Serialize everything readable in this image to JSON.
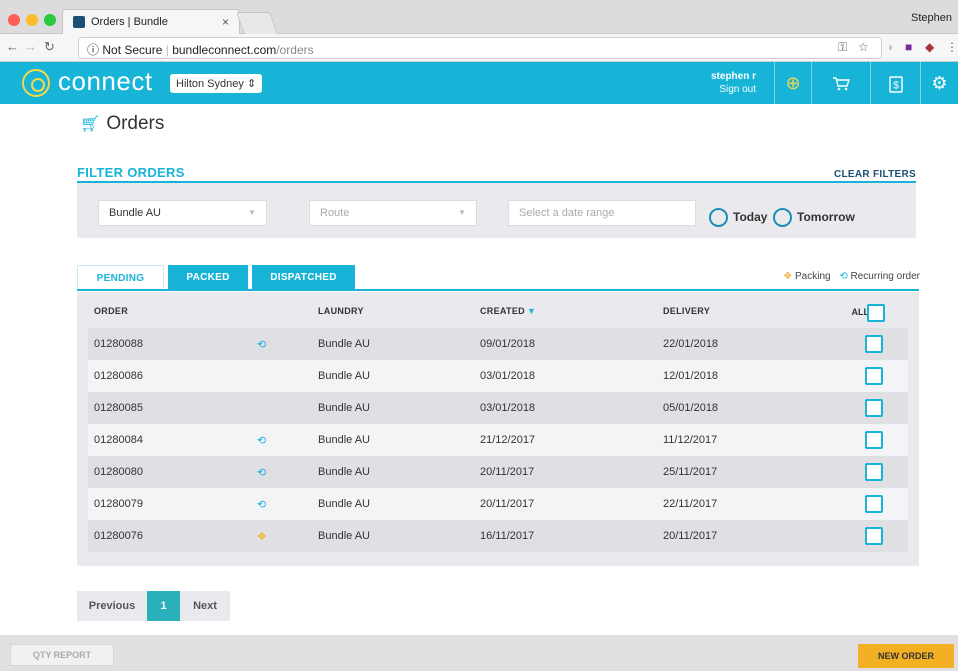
{
  "browser": {
    "tab_title": "Orders | Bundle",
    "tab_close": "×",
    "profile_name": "Stephen",
    "security_label": "Not Secure",
    "url_host": "bundleconnect.com",
    "url_path": "/orders",
    "info_glyph": "ⓘ"
  },
  "header": {
    "brand": "connect",
    "venue": "Hilton Sydney",
    "venue_caret": "⇕",
    "user_name": "stephen r",
    "sign_out": "Sign out",
    "icons": [
      "plus-circle-icon",
      "cart-icon",
      "invoice-icon",
      "settings-icon"
    ],
    "accent_color": "#17b4d8",
    "highlight_color": "#f2d84b"
  },
  "page": {
    "title": "Orders",
    "title_icon": "cart-icon"
  },
  "filters": {
    "label": "FILTER ORDERS",
    "clear_label": "CLEAR FILTERS",
    "laundry_value": "Bundle AU",
    "route_placeholder": "Route",
    "date_placeholder": "Select a date range",
    "today_label": "Today",
    "tomorrow_label": "Tomorrow"
  },
  "tabs": [
    {
      "label": "PENDING",
      "active": true
    },
    {
      "label": "PACKED",
      "active": false
    },
    {
      "label": "DISPATCHED",
      "active": false
    }
  ],
  "legend": {
    "packing_label": "Packing",
    "recurring_label": "Recurring order",
    "packing_color": "#f0b23a",
    "recurring_color": "#17b4d8"
  },
  "table": {
    "headers": {
      "order": "ORDER",
      "laundry": "LAUNDRY",
      "created": "CREATED",
      "delivery": "DELIVERY",
      "all": "ALL"
    },
    "sort_arrow": "▼",
    "rows": [
      {
        "order": "01280088",
        "flag": "recurring",
        "laundry": "Bundle AU",
        "created": "09/01/2018",
        "delivery": "22/01/2018"
      },
      {
        "order": "01280086",
        "flag": "",
        "laundry": "Bundle AU",
        "created": "03/01/2018",
        "delivery": "12/01/2018"
      },
      {
        "order": "01280085",
        "flag": "",
        "laundry": "Bundle AU",
        "created": "03/01/2018",
        "delivery": "05/01/2018"
      },
      {
        "order": "01280084",
        "flag": "recurring",
        "laundry": "Bundle AU",
        "created": "21/12/2017",
        "delivery": "11/12/2017"
      },
      {
        "order": "01280080",
        "flag": "recurring",
        "laundry": "Bundle AU",
        "created": "20/11/2017",
        "delivery": "25/11/2017"
      },
      {
        "order": "01280079",
        "flag": "recurring",
        "laundry": "Bundle AU",
        "created": "20/11/2017",
        "delivery": "22/11/2017"
      },
      {
        "order": "01280076",
        "flag": "packing",
        "laundry": "Bundle AU",
        "created": "16/11/2017",
        "delivery": "20/11/2017"
      }
    ]
  },
  "pagination": {
    "previous": "Previous",
    "current": "1",
    "next": "Next"
  },
  "footer": {
    "qty_report": "QTY REPORT",
    "new_order": "NEW ORDER"
  }
}
